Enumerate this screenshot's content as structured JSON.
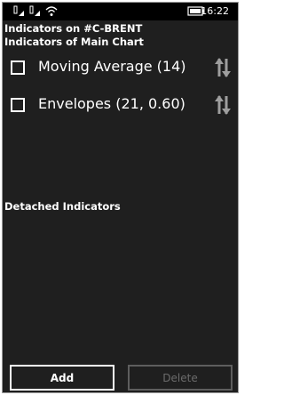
{
  "status_bar": {
    "time": "16:22",
    "icons": [
      "signal-bars-icon",
      "signal-bars-2-icon",
      "wifi-icon",
      "battery-icon"
    ]
  },
  "title": "Indicators on #C-BRENT",
  "main_chart": {
    "heading": "Indicators of Main Chart",
    "indicators": [
      {
        "label": "Moving Average (14)",
        "checked": false
      },
      {
        "label": "Envelopes (21, 0.60)",
        "checked": false
      }
    ]
  },
  "detached": {
    "heading": "Detached Indicators"
  },
  "buttons": {
    "add": "Add",
    "delete": "Delete"
  }
}
